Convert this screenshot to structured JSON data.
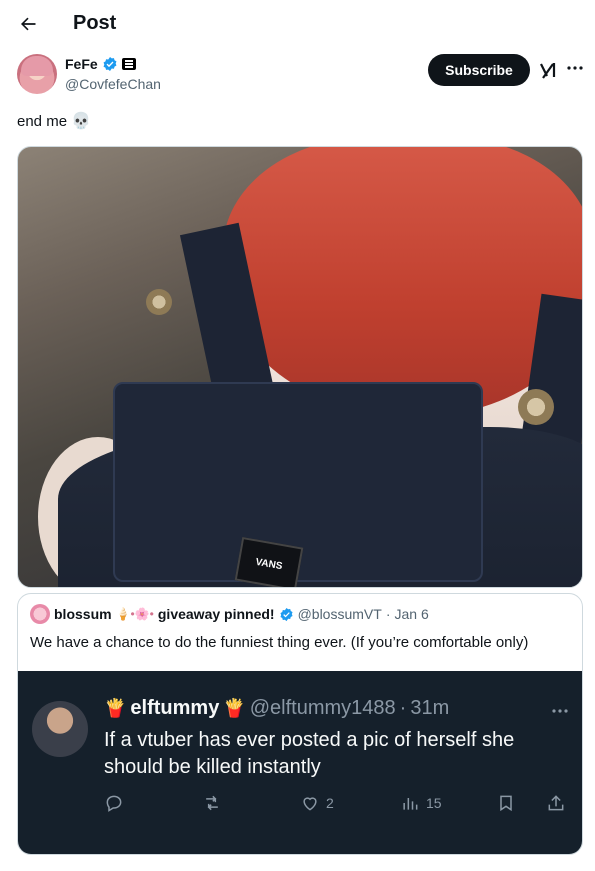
{
  "header": {
    "title": "Post"
  },
  "author": {
    "display_name": "FeFe",
    "handle": "@CovfefeChan",
    "subscribe_label": "Subscribe"
  },
  "tweet": {
    "text": "end me",
    "emoji": "💀"
  },
  "photo": {
    "tag_text": "VANS"
  },
  "quote": {
    "name": "blossum",
    "name_decoration": "🍦•🌸•",
    "name_suffix": "giveaway pinned!",
    "handle": "@blossumVT",
    "sep": "·",
    "date": "Jan 6",
    "text": "We have a chance to do the funniest thing ever. (If you’re comfortable only)",
    "screenshot": {
      "name": "elftummy",
      "name_emoji": "🍟",
      "handle": "@elftummy1488",
      "sep": "·",
      "time": "31m",
      "text": "If a vtuber has ever posted a pic of herself she should be killed instantly",
      "likes": "2",
      "views": "15"
    }
  },
  "colors": {
    "accent": "#1d9bf0",
    "text": "#0f1419",
    "muted": "#536471",
    "dark_bg": "#15202b"
  }
}
